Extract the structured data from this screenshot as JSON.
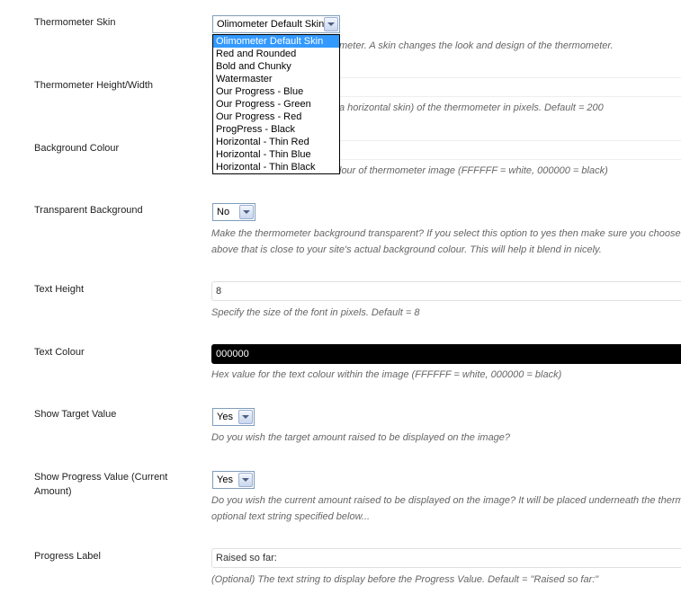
{
  "skin": {
    "label": "Thermometer Skin",
    "selected": "Olimometer Default Skin",
    "desc_visible": "meter. A skin changes the look and design of the thermometer.",
    "options": [
      "Olimometer Default Skin",
      "Red and Rounded",
      "Bold and Chunky",
      "Watermaster",
      "Our Progress - Blue",
      "Our Progress - Green",
      "Our Progress - Red",
      "ProgPress - Black",
      "Horizontal - Thin Red",
      "Horizontal - Thin Blue",
      "Horizontal - Thin Black"
    ]
  },
  "height_width": {
    "label": "Thermometer Height/Width",
    "desc_visible": "a horizontal skin) of the thermometer in pixels. Default = 200"
  },
  "background_colour": {
    "label": "Background Colour",
    "desc_visible": "lour of thermometer image (FFFFFF = white, 000000 = black)"
  },
  "transparent_background": {
    "label": "Transparent Background",
    "value": "No",
    "desc_line1": "Make the thermometer background transparent? If you select this option to yes then make sure you choose",
    "desc_line2": "above that is close to your site's actual background colour. This will help it blend in nicely."
  },
  "text_height": {
    "label": "Text Height",
    "value": "8",
    "desc": "Specify the size of the font in pixels. Default = 8"
  },
  "text_colour": {
    "label": "Text Colour",
    "value": "000000",
    "background": "#000000",
    "desc": "Hex value for the text colour within the image (FFFFFF = white, 000000 = black)"
  },
  "show_target": {
    "label": "Show Target Value",
    "value": "Yes",
    "desc": "Do you wish the target amount raised to be displayed on the image?"
  },
  "show_progress": {
    "label": "Show Progress Value (Current Amount)",
    "value": "Yes",
    "desc_line1": "Do you wish the current amount raised to be displayed on the image? It will be placed underneath the therm",
    "desc_line2": "optional text string specified below..."
  },
  "progress_label": {
    "label": "Progress Label",
    "value": "Raised so far:",
    "desc": "(Optional) The text string to display before the Progress Value. Default = \"Raised so far:\""
  },
  "colors": {
    "selection": "#3399ff",
    "select_border": "#7f9db9"
  }
}
